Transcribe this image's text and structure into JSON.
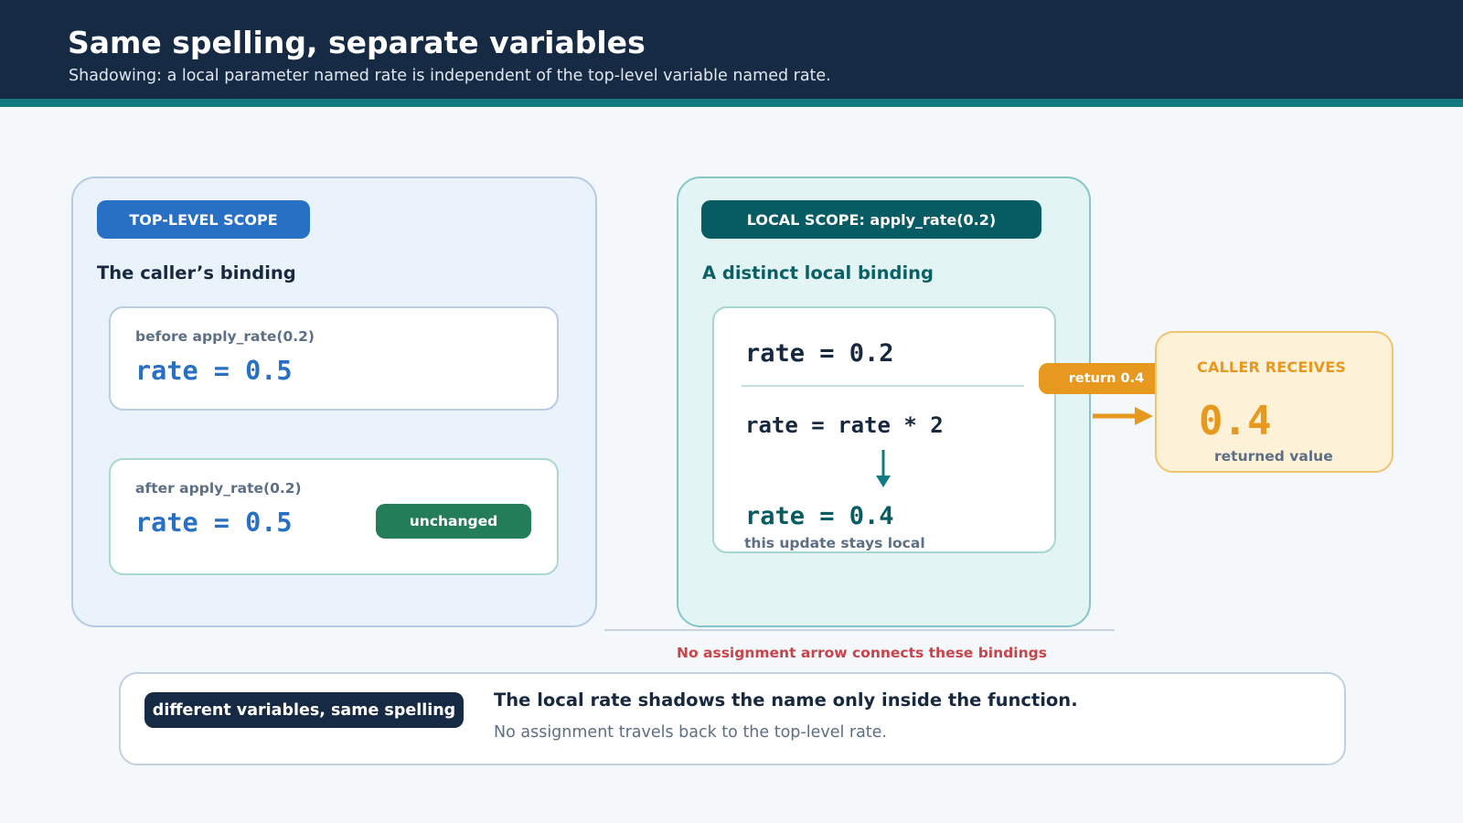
{
  "header": {
    "title": "Same spelling, separate variables",
    "subtitle": "Shadowing: a local parameter named rate is independent of the top-level variable named rate."
  },
  "top_scope": {
    "badge": "TOP-LEVEL SCOPE",
    "heading": "The caller’s binding",
    "before": {
      "caption": "before apply_rate(0.2)",
      "code": "rate = 0.5"
    },
    "after": {
      "caption": "after apply_rate(0.2)",
      "code": "rate = 0.5",
      "badge": "unchanged"
    }
  },
  "local_scope": {
    "badge": "LOCAL SCOPE: apply_rate(0.2)",
    "heading": "A distinct local binding",
    "lines": [
      "rate = 0.2",
      "rate = rate * 2",
      "rate = 0.4"
    ],
    "caption": "this update stays local"
  },
  "return_label": "return 0.4",
  "caller": {
    "title": "CALLER RECEIVES",
    "value": "0.4",
    "caption": "returned value"
  },
  "separation_note": "No assignment arrow connects these bindings",
  "footer": {
    "badge": "different variables, same spelling",
    "main": "The local rate shadows the name only inside the function.",
    "sub": "No assignment travels back to the top-level rate."
  },
  "colors": {
    "navy": "#172a44",
    "teal": "#127a80",
    "blue": "#2770c3",
    "green": "#237d58",
    "amber": "#e6991e",
    "red": "#c8434a"
  },
  "icons": [
    "arrow-down-icon",
    "arrow-right-icon"
  ]
}
